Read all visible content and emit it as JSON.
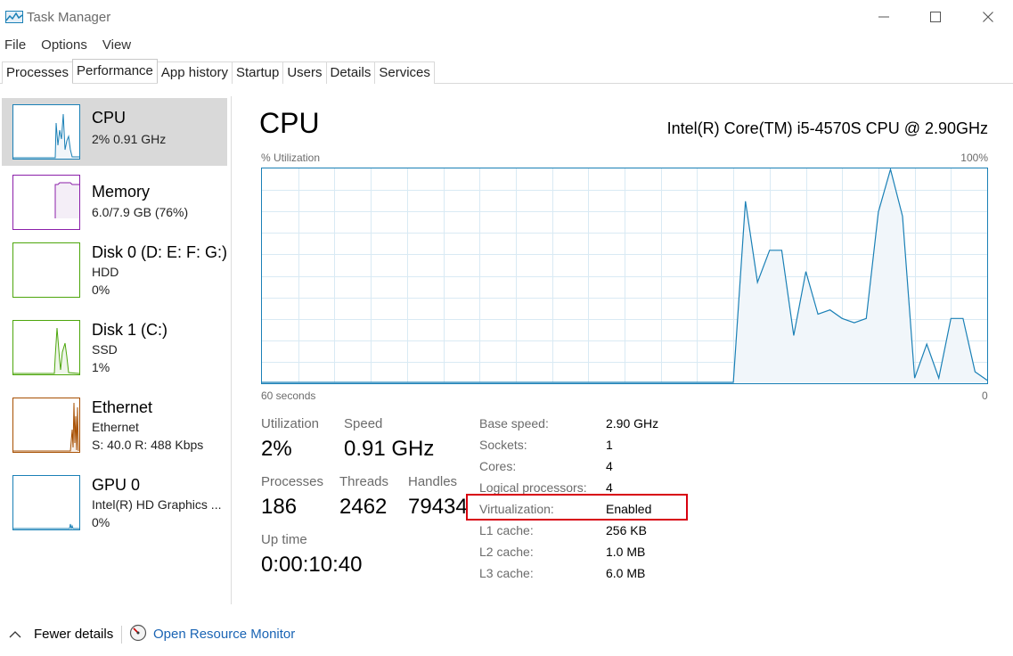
{
  "window": {
    "title": "Task Manager"
  },
  "menu": [
    "File",
    "Options",
    "View"
  ],
  "tabs": [
    {
      "label": "Processes",
      "active": false
    },
    {
      "label": "Performance",
      "active": true
    },
    {
      "label": "App history",
      "active": false
    },
    {
      "label": "Startup",
      "active": false
    },
    {
      "label": "Users",
      "active": false
    },
    {
      "label": "Details",
      "active": false
    },
    {
      "label": "Services",
      "active": false
    }
  ],
  "resources": [
    {
      "name": "CPU",
      "lines": [
        "2% 0.91 GHz"
      ],
      "color": "#1a80b6",
      "selected": true
    },
    {
      "name": "Memory",
      "lines": [
        "6.0/7.9 GB (76%)"
      ],
      "color": "#8b1fa9",
      "selected": false
    },
    {
      "name": "Disk 0 (D: E: F: G:)",
      "lines": [
        "HDD",
        "0%"
      ],
      "color": "#4da60c",
      "selected": false
    },
    {
      "name": "Disk 1 (C:)",
      "lines": [
        "SSD",
        "1%"
      ],
      "color": "#4da60c",
      "selected": false
    },
    {
      "name": "Ethernet",
      "lines": [
        "Ethernet",
        "S: 40.0  R: 488 Kbps"
      ],
      "color": "#a74f01",
      "selected": false
    },
    {
      "name": "GPU 0",
      "lines": [
        "Intel(R) HD Graphics ...",
        "0%"
      ],
      "color": "#1a80b6",
      "selected": false
    }
  ],
  "main": {
    "title": "CPU",
    "model": "Intel(R) Core(TM) i5-4570S CPU @ 2.90GHz",
    "graph_label": "% Utilization",
    "graph_max": "100%",
    "graph_time": "60 seconds",
    "graph_min": "0",
    "stats": {
      "utilization_label": "Utilization",
      "utilization": "2%",
      "speed_label": "Speed",
      "speed": "0.91 GHz",
      "processes_label": "Processes",
      "processes": "186",
      "threads_label": "Threads",
      "threads": "2462",
      "handles_label": "Handles",
      "handles": "79434",
      "uptime_label": "Up time",
      "uptime": "0:00:10:40"
    },
    "specs": [
      {
        "label": "Base speed:",
        "value": "2.90 GHz"
      },
      {
        "label": "Sockets:",
        "value": "1"
      },
      {
        "label": "Cores:",
        "value": "4"
      },
      {
        "label": "Logical processors:",
        "value": "4"
      },
      {
        "label": "Virtualization:",
        "value": "Enabled"
      },
      {
        "label": "L1 cache:",
        "value": "256 KB"
      },
      {
        "label": "L2 cache:",
        "value": "1.0 MB"
      },
      {
        "label": "L3 cache:",
        "value": "6.0 MB"
      }
    ],
    "highlighted_spec": "Virtualization:"
  },
  "footer": {
    "fewer_details": "Fewer details",
    "open_resource_monitor": "Open Resource Monitor"
  },
  "chart_data": {
    "type": "area",
    "ylabel": "% Utilization",
    "ylim": [
      0,
      100
    ],
    "x_range_label": "60 seconds",
    "x": [
      0,
      1,
      2,
      3,
      4,
      5,
      6,
      7,
      8,
      9,
      10,
      11,
      12,
      13,
      14,
      15,
      16,
      17,
      18,
      19,
      20,
      21,
      22,
      23,
      24,
      25,
      26,
      27,
      28,
      29,
      30,
      31,
      32,
      33,
      34,
      35,
      36,
      37,
      38,
      39,
      40,
      41,
      42,
      43,
      44,
      45,
      46,
      47,
      48,
      49,
      50,
      51,
      52,
      53,
      54,
      55,
      56,
      57,
      58,
      59,
      60
    ],
    "values": [
      0,
      0,
      0,
      0,
      0,
      0,
      0,
      0,
      0,
      0,
      0,
      0,
      0,
      0,
      0,
      0,
      0,
      0,
      0,
      0,
      0,
      0,
      0,
      0,
      0,
      0,
      0,
      0,
      0,
      0,
      0,
      0,
      0,
      0,
      0,
      0,
      0,
      0,
      0,
      0,
      85,
      47,
      62,
      62,
      22,
      52,
      32,
      34,
      30,
      28,
      30,
      80,
      100,
      78,
      2,
      18,
      2,
      30,
      30,
      5,
      1
    ]
  },
  "colors": {
    "cpu_line": "#1a80b6",
    "cpu_fill": "#f1f6fa",
    "grid": "#d9eaf4",
    "highlight_box": "#d8000f",
    "link": "#1a64b4"
  }
}
